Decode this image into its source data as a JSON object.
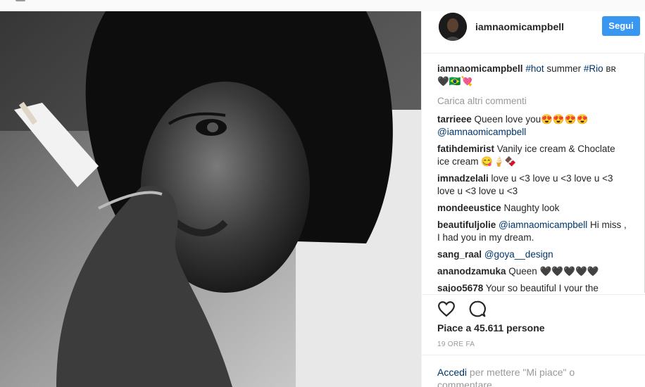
{
  "post": {
    "username": "iamnaomicampbell",
    "follow_label": "Segui",
    "caption": {
      "user": "iamnaomicampbell",
      "tag1": "#hot",
      "text1": " summer ",
      "tag2": "#Rio",
      "text2": " ʙʀ",
      "line2": "🖤🇧🇷💘"
    },
    "load_more": "Carica altri commenti",
    "comments": [
      {
        "user": "tarrieee",
        "text": " Queen love you😍😍😍😍",
        "mention": "@iamnaomicampbell",
        "after": ""
      },
      {
        "user": "fatihdemirist",
        "text": " Vanily ice cream & Choclate ice cream 😋🍦🍫",
        "mention": "",
        "after": ""
      },
      {
        "user": "imnadzelali",
        "text": " love u <3 love u <3 love u <3 love u <3 love u <3",
        "mention": "",
        "after": ""
      },
      {
        "user": "mondeeustice",
        "text": " Naughty look",
        "mention": "",
        "after": ""
      },
      {
        "user": "beautifuljolie",
        "text": " ",
        "mention": "@iamnaomicampbell",
        "after": " Hi miss , I had you in my dream."
      },
      {
        "user": "sang_raal",
        "text": " ",
        "mention": "@goya__design",
        "after": ""
      },
      {
        "user": "ananodzamuka",
        "text": " Queen 🖤🖤🖤🖤🖤",
        "mention": "",
        "after": ""
      },
      {
        "user": "sajoo5678",
        "text": " Your so beautiful I your the",
        "mention": "",
        "after": ""
      }
    ],
    "likes": "Piace a 45.611 persone",
    "time": "19 ORE FA",
    "login": {
      "link": "Accedi",
      "text": " per mettere \"Mi piace\" o commentare."
    }
  },
  "icons": {
    "like": "heart-icon",
    "comment": "comment-bubble-icon"
  },
  "colors": {
    "follow_button": "#3897f0",
    "link": "#003569",
    "muted": "#999999"
  }
}
